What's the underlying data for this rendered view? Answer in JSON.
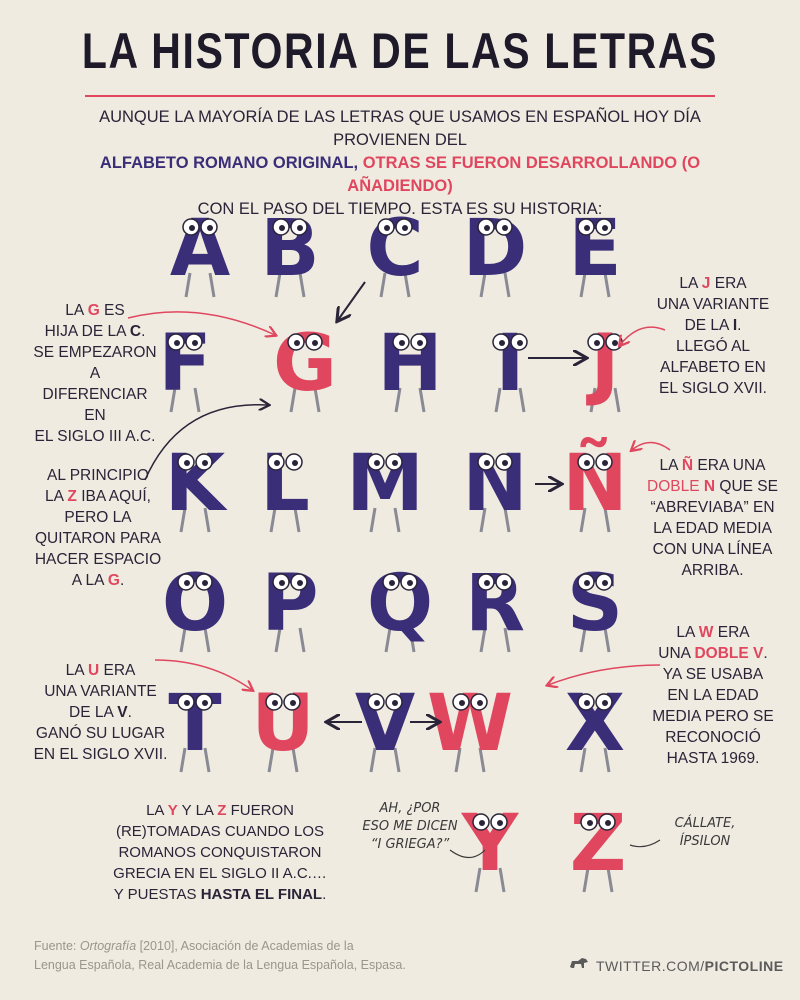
{
  "title": "LA HISTORIA DE LAS LETRAS",
  "intro": {
    "line1": "AUNQUE LA MAYORÍA DE LAS LETRAS QUE USAMOS EN ESPAÑOL HOY DÍA PROVIENEN DEL",
    "line2_blue": "ALFABETO ROMANO ORIGINAL,",
    "line2_red": "OTRAS SE FUERON DESARROLLANDO (O AÑADIENDO)",
    "line3": "CON EL PASO DEL TIEMPO. ESTA ES SU HISTORIA:"
  },
  "letters": [
    "A",
    "B",
    "C",
    "D",
    "E",
    "F",
    "G",
    "H",
    "I",
    "J",
    "K",
    "L",
    "M",
    "N",
    "Ñ",
    "O",
    "P",
    "Q",
    "R",
    "S",
    "T",
    "U",
    "V",
    "W",
    "X",
    "Y",
    "Z"
  ],
  "colors": {
    "purple": "#3b2e78",
    "red": "#e0475f",
    "bg": "#efebe1",
    "ghost": "#b9a7b8"
  },
  "notes": {
    "g": {
      "l1a": "LA ",
      "l1b": "G",
      "l1c": " ES",
      "l2a": "HIJA DE LA ",
      "l2b": "C",
      "l2c": ".",
      "l3": "SE EMPEZARON A",
      "l4": "DIFERENCIAR EN",
      "l5": "EL SIGLO III A.C."
    },
    "j": {
      "l1a": "LA ",
      "l1b": "J",
      "l1c": " ERA",
      "l2": "UNA VARIANTE",
      "l3a": "DE LA ",
      "l3b": "I",
      "l3c": ".",
      "l4": "LLEGÓ AL",
      "l5": "ALFABETO EN",
      "l6": "EL SIGLO XVII."
    },
    "z": {
      "l1": "AL PRINCIPIO",
      "l2a": "LA ",
      "l2b": "Z",
      "l2c": " IBA AQUÍ,",
      "l3": "PERO LA",
      "l4": "QUITARON PARA",
      "l5": "HACER ESPACIO",
      "l6a": "A LA ",
      "l6b": "G",
      "l6c": "."
    },
    "n": {
      "l1a": "LA ",
      "l1b": "Ñ",
      "l1c": " ERA UNA",
      "l2a": "DOBLE ",
      "l2b": "N",
      "l2c": " QUE SE",
      "l3": "“ABREVIABA” EN",
      "l4": "LA EDAD MEDIA",
      "l5": "CON UNA LÍNEA",
      "l6": "ARRIBA."
    },
    "u": {
      "l1a": "LA ",
      "l1b": "U",
      "l1c": " ERA",
      "l2": "UNA VARIANTE",
      "l3a": "DE LA ",
      "l3b": "V",
      "l3c": ".",
      "l4": "GANÓ SU LUGAR",
      "l5": "EN EL SIGLO XVII."
    },
    "w": {
      "l1a": "LA ",
      "l1b": "W",
      "l1c": " ERA",
      "l2a": "UNA ",
      "l2b": "DOBLE V",
      "l2c": ".",
      "l3": "YA SE USABA",
      "l4": "EN LA EDAD",
      "l5": "MEDIA PERO SE",
      "l6": "RECONOCIÓ",
      "l7": "HASTA 1969."
    },
    "yz": {
      "l1a": "LA ",
      "l1b": "Y",
      "l1c": " Y LA ",
      "l1d": "Z",
      "l1e": " FUERON",
      "l2": "(RE)TOMADAS CUANDO LOS",
      "l3": "ROMANOS CONQUISTARON",
      "l4": "GRECIA EN EL SIGLO II A.C.…",
      "l5a": "Y PUESTAS ",
      "l5b": "HASTA EL FINAL",
      "l5c": "."
    }
  },
  "speech": {
    "y1": "AH, ¿POR",
    "y2": "ESO ME DICEN",
    "y3": "“I GRIEGA?”",
    "z1": "CÁLLATE,",
    "z2": "ÍPSILON"
  },
  "footer": {
    "l1a": "Fuente: ",
    "l1b": "Ortografía",
    "l1c": " [2010], Asociación de Academias de la",
    "l2": "Lengua Española, Real Academia de la Lengua Española, Espasa."
  },
  "brand": {
    "prefix": "TWITTER.COM/",
    "name": "PICTOLINE"
  }
}
